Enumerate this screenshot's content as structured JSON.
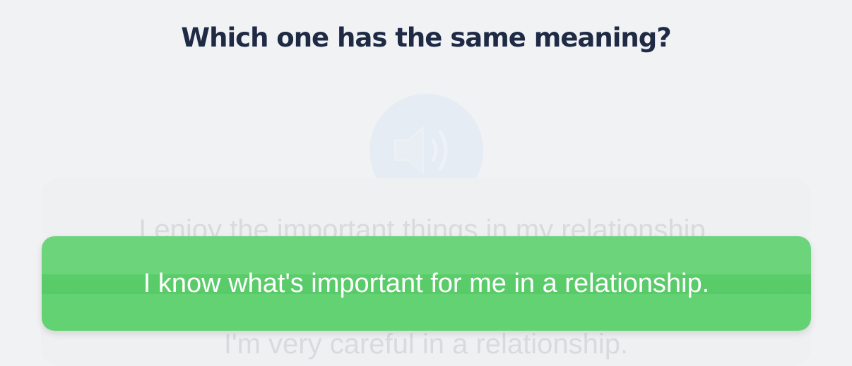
{
  "question": {
    "title": "Which one has the same meaning?"
  },
  "audio_button": {
    "icon": "speaker-icon"
  },
  "options": [
    {
      "label": "I enjoy the important things in my relationship."
    },
    {
      "label": "I know what's important for me in a relationship.",
      "selected": true
    },
    {
      "label": "I'm very careful in a relationship."
    }
  ],
  "colors": {
    "background": "#f1f2f4",
    "title": "#1f2a45",
    "selected_option": "#63d273",
    "faded_text": "#d8dadd",
    "audio_circle": "#e5ecf4"
  }
}
